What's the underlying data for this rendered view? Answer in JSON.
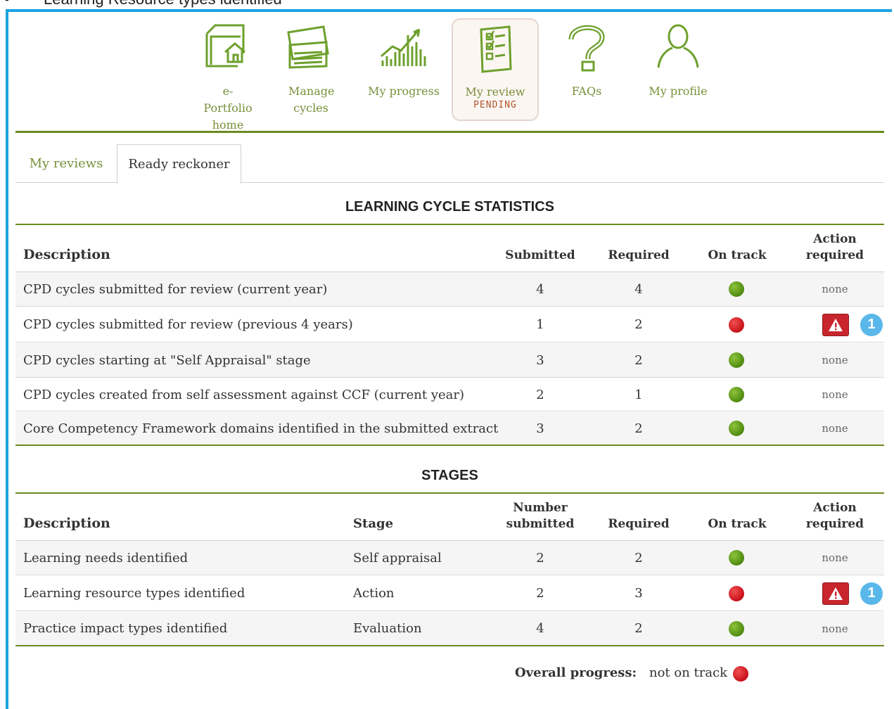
{
  "caption": {
    "bullet": "•",
    "text": "Learning Resource types identified"
  },
  "nav": {
    "items": [
      {
        "label": "e-Portfolio home",
        "icon": "eportfolio-home-icon"
      },
      {
        "label": "Manage cycles",
        "icon": "manage-cycles-icon"
      },
      {
        "label": "My progress",
        "icon": "my-progress-icon"
      },
      {
        "label": "My review",
        "sublabel": "PENDING",
        "icon": "my-review-icon",
        "active": true
      },
      {
        "label": "FAQs",
        "icon": "faq-icon"
      },
      {
        "label": "My profile",
        "icon": "my-profile-icon"
      }
    ]
  },
  "tabs": [
    {
      "label": "My reviews",
      "active": false
    },
    {
      "label": "Ready reckoner",
      "active": true
    }
  ],
  "stats": {
    "title": "LEARNING CYCLE STATISTICS",
    "headers": {
      "description": "Description",
      "submitted": "Submitted",
      "required": "Required",
      "on_track": "On track",
      "action": "Action required"
    },
    "rows": [
      {
        "description": "CPD cycles submitted for review (current year)",
        "submitted": "4",
        "required": "4",
        "status": "green",
        "action": "none"
      },
      {
        "description": "CPD cycles submitted for review (previous 4 years)",
        "submitted": "1",
        "required": "2",
        "status": "red",
        "action": "warning",
        "badge": "1"
      },
      {
        "description": "CPD cycles starting at \"Self Appraisal\" stage",
        "submitted": "3",
        "required": "2",
        "status": "green",
        "action": "none"
      },
      {
        "description": "CPD cycles created from self assessment against CCF (current year)",
        "submitted": "2",
        "required": "1",
        "status": "green",
        "action": "none"
      },
      {
        "description": "Core Competency Framework domains identified in the submitted extract",
        "submitted": "3",
        "required": "2",
        "status": "green",
        "action": "none"
      }
    ]
  },
  "stages": {
    "title": "STAGES",
    "headers": {
      "description": "Description",
      "stage": "Stage",
      "submitted": "Number submitted",
      "required": "Required",
      "on_track": "On track",
      "action": "Action required"
    },
    "rows": [
      {
        "description": "Learning needs identified",
        "stage": "Self appraisal",
        "submitted": "2",
        "required": "2",
        "status": "green",
        "action": "none"
      },
      {
        "description": "Learning resource types identified",
        "stage": "Action",
        "submitted": "2",
        "required": "3",
        "status": "red",
        "action": "warning",
        "badge": "1"
      },
      {
        "description": "Practice impact types identified",
        "stage": "Evaluation",
        "submitted": "4",
        "required": "2",
        "status": "green",
        "action": "none"
      }
    ]
  },
  "overall": {
    "label": "Overall progress:",
    "value": "not on track",
    "status": "red"
  },
  "colors": {
    "accent_green": "#6a8b1f",
    "link_green": "#7a8f3a",
    "frame_blue": "#1aa3e0",
    "status_green": "#4f8a10",
    "status_red": "#c8101a",
    "badge_blue": "#5ab7ea"
  }
}
